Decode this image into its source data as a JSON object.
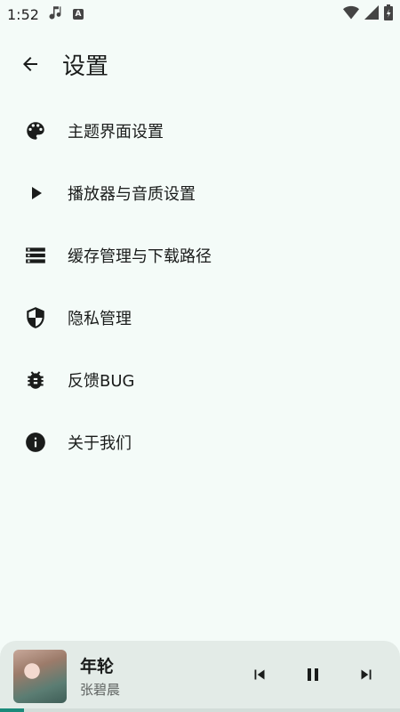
{
  "status_bar": {
    "time": "1:52",
    "notification_badge": "A"
  },
  "header": {
    "title": "设置"
  },
  "menu": [
    {
      "label": "主题界面设置",
      "icon": "palette-icon"
    },
    {
      "label": "播放器与音质设置",
      "icon": "play-icon"
    },
    {
      "label": "缓存管理与下载路径",
      "icon": "storage-icon"
    },
    {
      "label": "隐私管理",
      "icon": "shield-icon"
    },
    {
      "label": "反馈BUG",
      "icon": "bug-icon"
    },
    {
      "label": "关于我们",
      "icon": "info-icon"
    }
  ],
  "player": {
    "title": "年轮",
    "artist": "张碧晨",
    "progress": 0.06
  },
  "colors": {
    "background": "#f4fbf8",
    "player_bg": "#e3ebe7",
    "accent": "#1b8a7a"
  }
}
